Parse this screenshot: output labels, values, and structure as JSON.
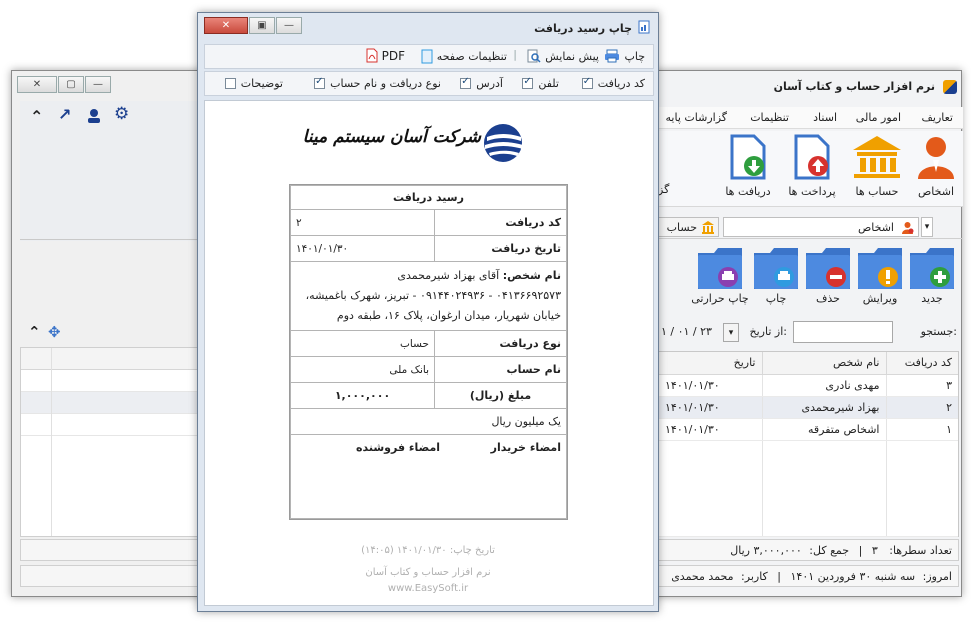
{
  "main_window": {
    "title": "نرم افزار حساب و کتاب آسان",
    "menu": [
      "تعاریف",
      "امور مالی",
      "اسناد",
      "تنظیمات",
      "گزارشات پایه"
    ],
    "toolbar": {
      "people": "اشخاص",
      "accounts": "حساب ها",
      "payments": "پرداخت ها",
      "receipts": "دریافت ها",
      "reports": "گزا"
    },
    "tabs": {
      "people": "اشخاص",
      "account": "حساب"
    },
    "actions": {
      "new": "جدید",
      "edit": "ویرایش",
      "delete": "حذف",
      "print": "چاپ",
      "thermal_print": "چاپ حرارتی"
    },
    "search": {
      "label": "جستجو:",
      "from_date": "از تاریخ:",
      "date_value": "۱ / ۰۱ / ۲۳"
    },
    "table": {
      "headers": [
        "کد دریافت",
        "نام شخص",
        "تاریخ"
      ],
      "rows": [
        [
          "۳",
          "مهدی نادری",
          "۱۴۰۱/۰۱/۳۰"
        ],
        [
          "۲",
          "بهزاد شیرمحمدی",
          "۱۴۰۱/۰۱/۳۰"
        ],
        [
          "۱",
          "اشخاص متفرقه",
          "۱۴۰۱/۰۱/۳۰"
        ]
      ]
    },
    "footer": {
      "row_count_label": "تعداد سطرها:",
      "row_count": "۳",
      "sum_label": "جمع کل:",
      "sum_value": "۳,۰۰۰,۰۰۰ ریال"
    },
    "statusbar": {
      "today_label": "امروز:",
      "today": "سه شنبه ۳۰ فروردین ۱۴۰۱",
      "user_label": "کاربر:",
      "user": "محمد محمدی"
    }
  },
  "print_dialog": {
    "title": "چاپ رسید دریافت",
    "toolbar": {
      "print": "چاپ",
      "preview": "پیش نمایش",
      "page_setup": "تنظیمات صفحه",
      "pdf": "PDF"
    },
    "options": [
      {
        "label": "کد دریافت",
        "checked": true
      },
      {
        "label": "تلفن",
        "checked": true
      },
      {
        "label": "آدرس",
        "checked": true
      },
      {
        "label": "نوع دریافت و نام حساب",
        "checked": true
      },
      {
        "label": "توضیحات",
        "checked": false
      }
    ],
    "company_name": "شرکت آسان سیستم مینا",
    "receipt": {
      "title": "رسید دریافت",
      "code_label": "کد دریافت",
      "code": "۲",
      "date_label": "تاریخ دریافت",
      "date": "۱۴۰۱/۰۱/۳۰",
      "person_label": "نام شخص:",
      "person": "آقای بهزاد شیرمحمدی",
      "person_details": "۰۴۱۳۶۶۹۲۵۷۳ - ۰۹۱۴۴۰۲۴۹۳۶ - تبریز، شهرک باغمیشه، خیابان شهریار، میدان ارغوان، پلاک ۱۶، طبقه دوم",
      "type_label": "نوع دریافت",
      "type": "حساب",
      "account_label": "نام حساب",
      "account": "بانک ملی",
      "amount_label": "مبلغ (ریال)",
      "amount": "۱,۰۰۰,۰۰۰",
      "amount_words": "یک میلیون ریال",
      "buyer_sign": "امضاء خریدار",
      "seller_sign": "امضاء فروشنده"
    },
    "print_date": "تاریخ چاپ: ۱۴۰۱/۰۱/۳۰ (۱۴:۰۵)",
    "software_name": "نرم افزار حساب و کتاب آسان",
    "website": "www.EasySoft.ir"
  },
  "colors": {
    "blue_folder": "#3b74c9",
    "accent_orange": "#f0a000",
    "green": "#2e9e3e",
    "red": "#d7322e",
    "purple": "#8a3fb0",
    "navy": "#1b3f8f"
  }
}
